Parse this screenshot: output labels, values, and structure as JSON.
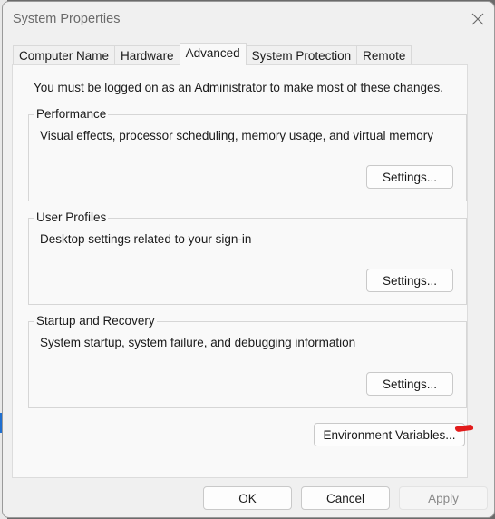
{
  "window": {
    "title": "System Properties",
    "close_icon": "close-icon"
  },
  "tabs": [
    {
      "label": "Computer Name",
      "active": false
    },
    {
      "label": "Hardware",
      "active": false
    },
    {
      "label": "Advanced",
      "active": true
    },
    {
      "label": "System Protection",
      "active": false
    },
    {
      "label": "Remote",
      "active": false
    }
  ],
  "advanced": {
    "notice": "You must be logged on as an Administrator to make most of these changes.",
    "groups": [
      {
        "label": "Performance",
        "description": "Visual effects, processor scheduling, memory usage, and virtual memory",
        "button": "Settings..."
      },
      {
        "label": "User Profiles",
        "description": "Desktop settings related to your sign-in",
        "button": "Settings..."
      },
      {
        "label": "Startup and Recovery",
        "description": "System startup, system failure, and debugging information",
        "button": "Settings..."
      }
    ],
    "env_button": "Environment Variables..."
  },
  "footer": {
    "ok": "OK",
    "cancel": "Cancel",
    "apply": "Apply"
  },
  "annotation": {
    "color": "#e21b1b"
  }
}
